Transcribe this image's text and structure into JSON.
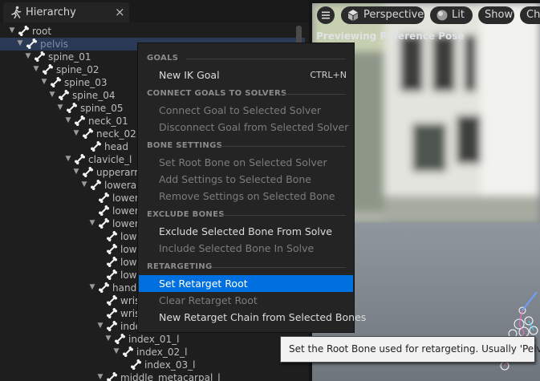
{
  "hierarchy": {
    "tab_title": "Hierarchy",
    "close_glyph": "×",
    "bones": [
      {
        "name": "root"
      },
      {
        "name": "pelvis"
      },
      {
        "name": "spine_01"
      },
      {
        "name": "spine_02"
      },
      {
        "name": "spine_03"
      },
      {
        "name": "spine_04"
      },
      {
        "name": "spine_05"
      },
      {
        "name": "neck_01"
      },
      {
        "name": "neck_02"
      },
      {
        "name": "head"
      },
      {
        "name": "clavicle_l"
      },
      {
        "name": "upperarm"
      },
      {
        "name": "lowera"
      },
      {
        "name": "lower"
      },
      {
        "name": "lower"
      },
      {
        "name": "lower"
      },
      {
        "name": "low"
      },
      {
        "name": "low"
      },
      {
        "name": "low"
      },
      {
        "name": "low"
      },
      {
        "name": "hand"
      },
      {
        "name": "wris"
      },
      {
        "name": "wris"
      },
      {
        "name": "inde"
      },
      {
        "name": "index_01_l"
      },
      {
        "name": "index_02_l"
      },
      {
        "name": "index_03_l"
      },
      {
        "name": "middle_metacarpal_l"
      }
    ]
  },
  "viewport": {
    "menu_icon": "hamburger-icon",
    "perspective_label": "Perspective",
    "lit_label": "Lit",
    "show_label": "Show",
    "cut_label": "Ch",
    "notice": "Previewing Reference Pose"
  },
  "context_menu": {
    "sections": [
      {
        "header": "GOALS",
        "items": [
          {
            "label": "New IK Goal",
            "shortcut": "CTRL+N",
            "enabled": true
          }
        ]
      },
      {
        "header": "CONNECT GOALS TO SOLVERS",
        "items": [
          {
            "label": "Connect Goal to Selected Solver",
            "enabled": false
          },
          {
            "label": "Disconnect Goal from Selected Solver",
            "enabled": false
          }
        ]
      },
      {
        "header": "BONE SETTINGS",
        "items": [
          {
            "label": "Set Root Bone on Selected Solver",
            "enabled": false
          },
          {
            "label": "Add Settings to Selected Bone",
            "enabled": false
          },
          {
            "label": "Remove Settings on Selected Bone",
            "enabled": false
          }
        ]
      },
      {
        "header": "EXCLUDE BONES",
        "items": [
          {
            "label": "Exclude Selected Bone From Solve",
            "enabled": true
          },
          {
            "label": "Include Selected Bone In Solve",
            "enabled": false
          }
        ]
      },
      {
        "header": "RETARGETING",
        "items": [
          {
            "label": "Set Retarget Root",
            "enabled": true,
            "highlighted": true
          },
          {
            "label": "Clear Retarget Root",
            "enabled": false
          },
          {
            "label": "New Retarget Chain from Selected Bones",
            "enabled": true
          }
        ]
      }
    ]
  },
  "tooltip": {
    "text": "Set the Root Bone used for retargeting. Usually 'Pelvis'."
  },
  "colors": {
    "highlight": "#0070e0",
    "selected_row": "#2a3a56",
    "panel_bg": "#1e1e1e",
    "menu_bg": "#242424"
  }
}
